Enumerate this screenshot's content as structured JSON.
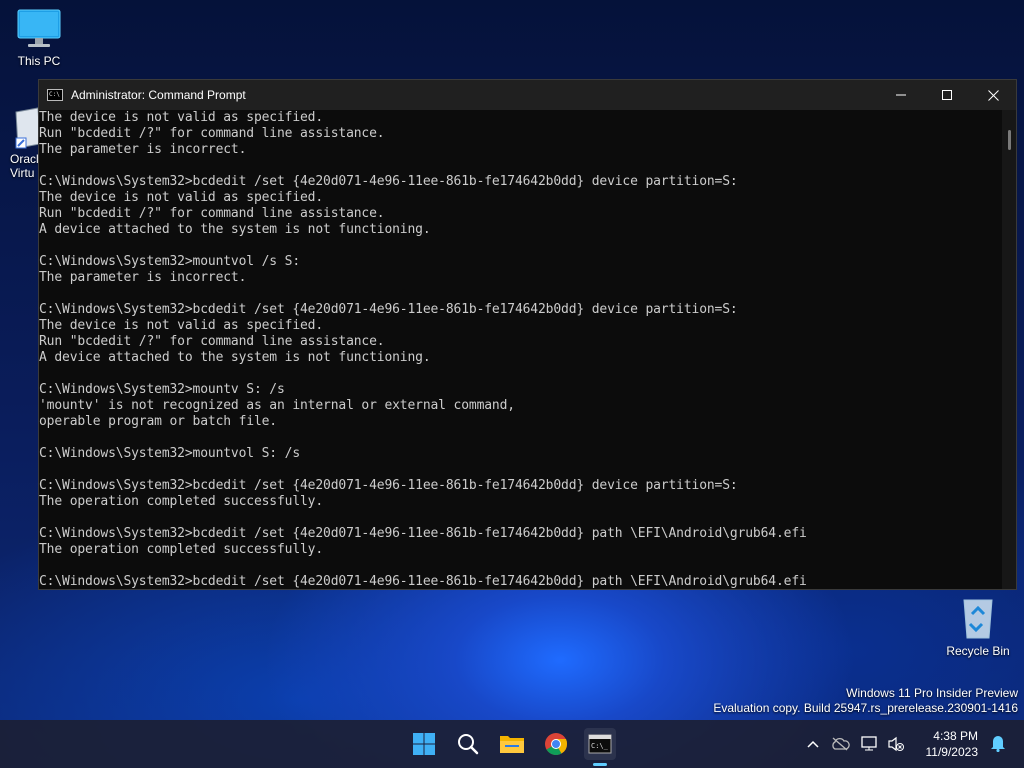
{
  "desktop": {
    "this_pc_label": "This PC",
    "oracle_label_line1": "Oracl",
    "oracle_label_line2": "Virtu",
    "recycle_label": "Recycle Bin",
    "watermark_line1": "Windows 11 Pro Insider Preview",
    "watermark_line2": "Evaluation copy. Build 25947.rs_prerelease.230901-1416"
  },
  "window": {
    "title": "Administrator: Command Prompt",
    "minimize": "—",
    "maximize": "☐",
    "close": "✕",
    "console_lines": [
      "The device is not valid as specified.",
      "Run \"bcdedit /?\" for command line assistance.",
      "The parameter is incorrect.",
      "",
      "C:\\Windows\\System32>bcdedit /set {4e20d071-4e96-11ee-861b-fe174642b0dd} device partition=S:",
      "The device is not valid as specified.",
      "Run \"bcdedit /?\" for command line assistance.",
      "A device attached to the system is not functioning.",
      "",
      "C:\\Windows\\System32>mountvol /s S:",
      "The parameter is incorrect.",
      "",
      "C:\\Windows\\System32>bcdedit /set {4e20d071-4e96-11ee-861b-fe174642b0dd} device partition=S:",
      "The device is not valid as specified.",
      "Run \"bcdedit /?\" for command line assistance.",
      "A device attached to the system is not functioning.",
      "",
      "C:\\Windows\\System32>mountv S: /s",
      "'mountv' is not recognized as an internal or external command,",
      "operable program or batch file.",
      "",
      "C:\\Windows\\System32>mountvol S: /s",
      "",
      "C:\\Windows\\System32>bcdedit /set {4e20d071-4e96-11ee-861b-fe174642b0dd} device partition=S:",
      "The operation completed successfully.",
      "",
      "C:\\Windows\\System32>bcdedit /set {4e20d071-4e96-11ee-861b-fe174642b0dd} path \\EFI\\Android\\grub64.efi",
      "The operation completed successfully.",
      ""
    ],
    "current_line_before_cursor": "C:\\Windows\\System32>bcdedit /set {4e20d071-4e96-11ee-861b-fe174642b0dd} path \\EFI\\Android\\grub6",
    "current_line_cursor_char": "4",
    "current_line_after_cursor": ".efi"
  },
  "taskbar": {
    "icons": [
      "start-icon",
      "search-icon",
      "file-explorer-icon",
      "chrome-icon",
      "terminal-icon"
    ],
    "time": "4:38 PM",
    "date": "11/9/2023"
  },
  "colors": {
    "accent": "#60cdff",
    "console_bg": "#0c0c0c",
    "console_fg": "#cccccc"
  }
}
